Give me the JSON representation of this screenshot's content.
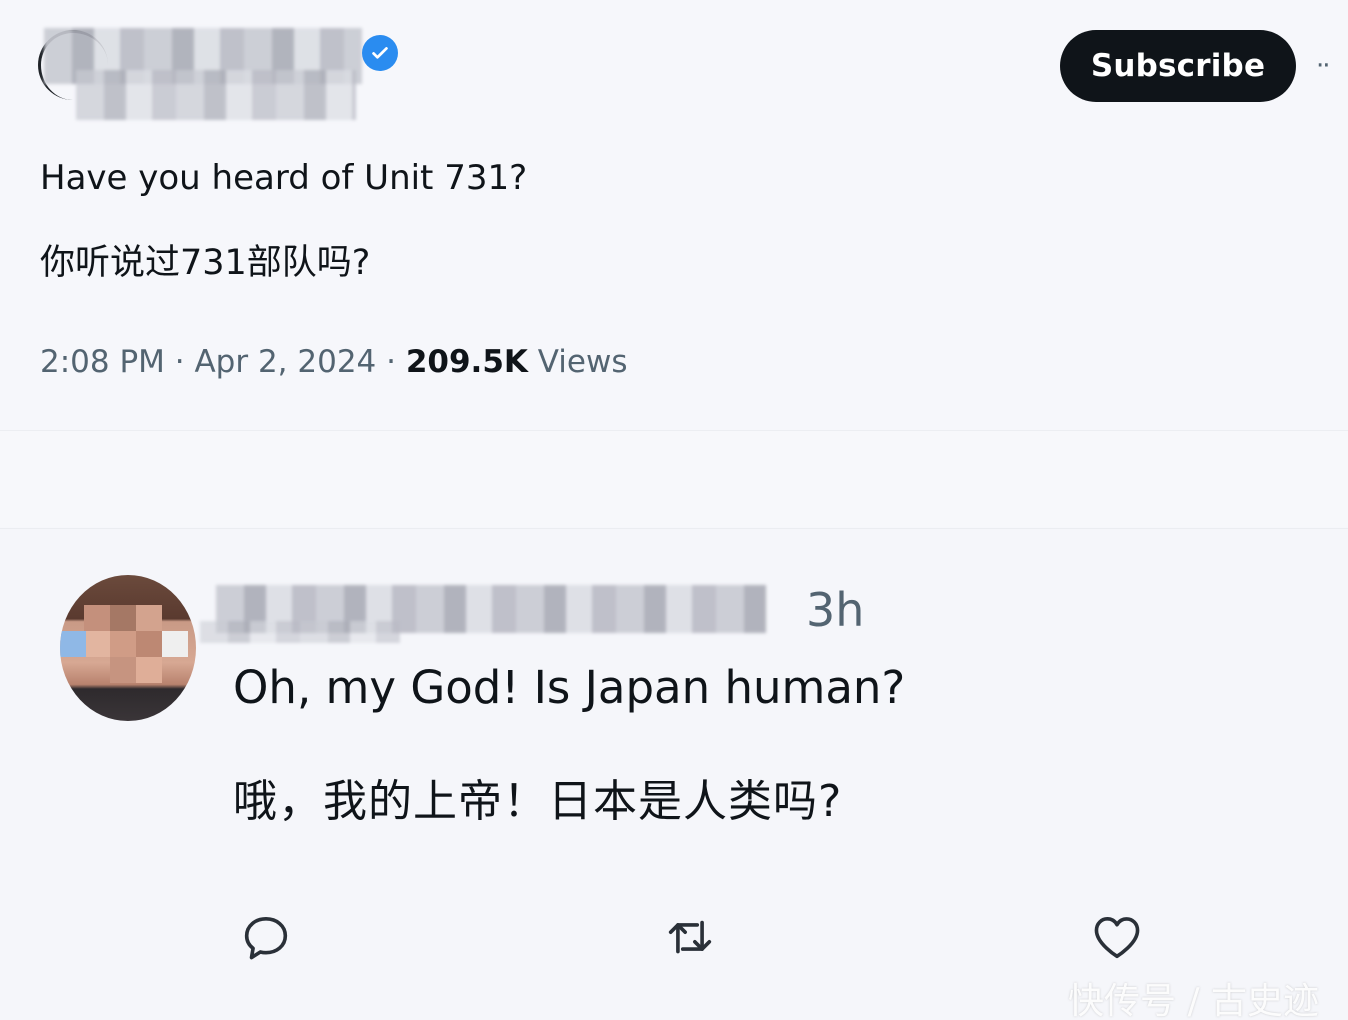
{
  "tweet": {
    "verified_badge_icon": "verified-check-icon",
    "subscribe_label": "Subscribe",
    "more_icon": "more-options-icon",
    "more_label": "··",
    "text_en": "Have you heard of Unit 731?",
    "text_zh": "你听说过731部队吗?",
    "timestamp": "2:08 PM · Apr 2, 2024 · ",
    "views_count": "209.5K",
    "views_label": " Views"
  },
  "reply": {
    "time": "3h",
    "text_en": "Oh, my God! Is Japan human?",
    "text_zh": "哦，我的上帝！日本是人类吗?",
    "actions": {
      "reply_icon": "reply-bubble-icon",
      "retweet_icon": "retweet-icon",
      "like_icon": "heart-icon"
    }
  },
  "watermark": "快传号 / 古史迹",
  "colors": {
    "accent_verified": "#2a8cf0",
    "button_bg": "#0f1419",
    "text_primary": "#0f1419",
    "text_secondary": "#536471"
  }
}
